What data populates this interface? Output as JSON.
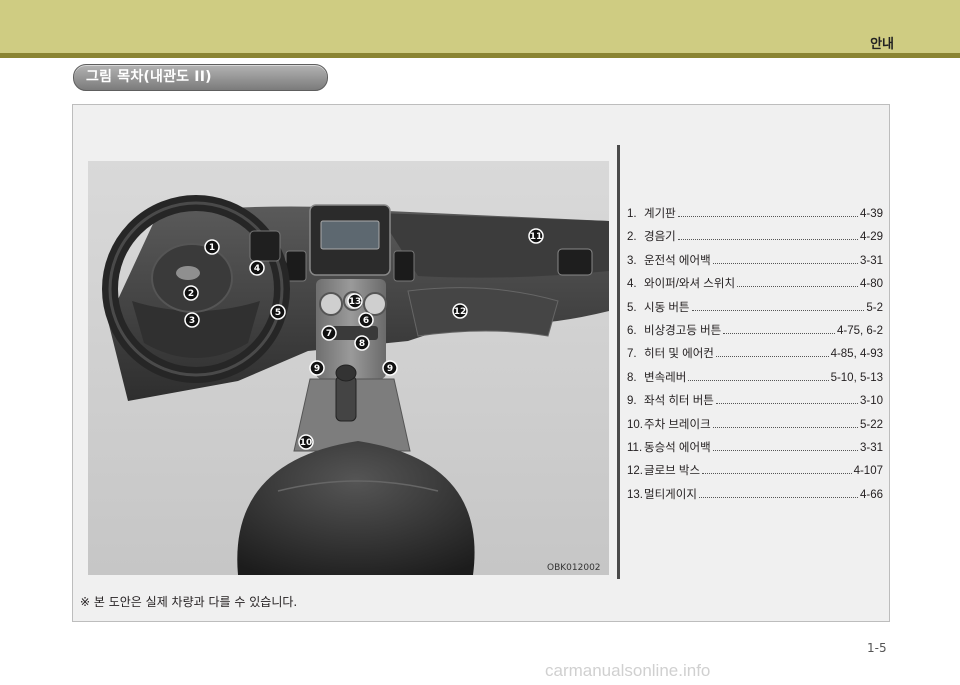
{
  "header": {
    "title": "안내",
    "section_title": "그림 목차(내관도 II)"
  },
  "figure": {
    "code": "OBK012002"
  },
  "callouts": [
    "1",
    "2",
    "3",
    "4",
    "5",
    "6",
    "7",
    "8",
    "9",
    "9",
    "10",
    "11",
    "12",
    "13"
  ],
  "toc": [
    {
      "num": "1.",
      "label": "계기판",
      "page": "4-39"
    },
    {
      "num": "2.",
      "label": "경음기",
      "page": "4-29"
    },
    {
      "num": "3.",
      "label": "운전석 에어백",
      "page": "3-31"
    },
    {
      "num": "4.",
      "label": "와이퍼/와셔 스위치",
      "page": "4-80"
    },
    {
      "num": "5.",
      "label": "시동 버튼",
      "page": "5-2"
    },
    {
      "num": "6.",
      "label": "비상경고등 버튼",
      "page": "4-75, 6-2"
    },
    {
      "num": "7.",
      "label": "히터 및 에어컨",
      "page": "4-85, 4-93"
    },
    {
      "num": "8.",
      "label": "변속레버",
      "page": "5-10, 5-13"
    },
    {
      "num": "9.",
      "label": "좌석 히터 버튼",
      "page": "3-10"
    },
    {
      "num": "10.",
      "label": "주차 브레이크",
      "page": "5-22"
    },
    {
      "num": "11.",
      "label": "동승석 에어백",
      "page": "3-31"
    },
    {
      "num": "12.",
      "label": "글로브 박스",
      "page": "4-107"
    },
    {
      "num": "13.",
      "label": "멀티게이지",
      "page": "4-66"
    }
  ],
  "note": "※ 본 도안은 실제 차량과 다를 수 있습니다.",
  "page_number": "1-5",
  "watermark": "carmanualsonline.info"
}
